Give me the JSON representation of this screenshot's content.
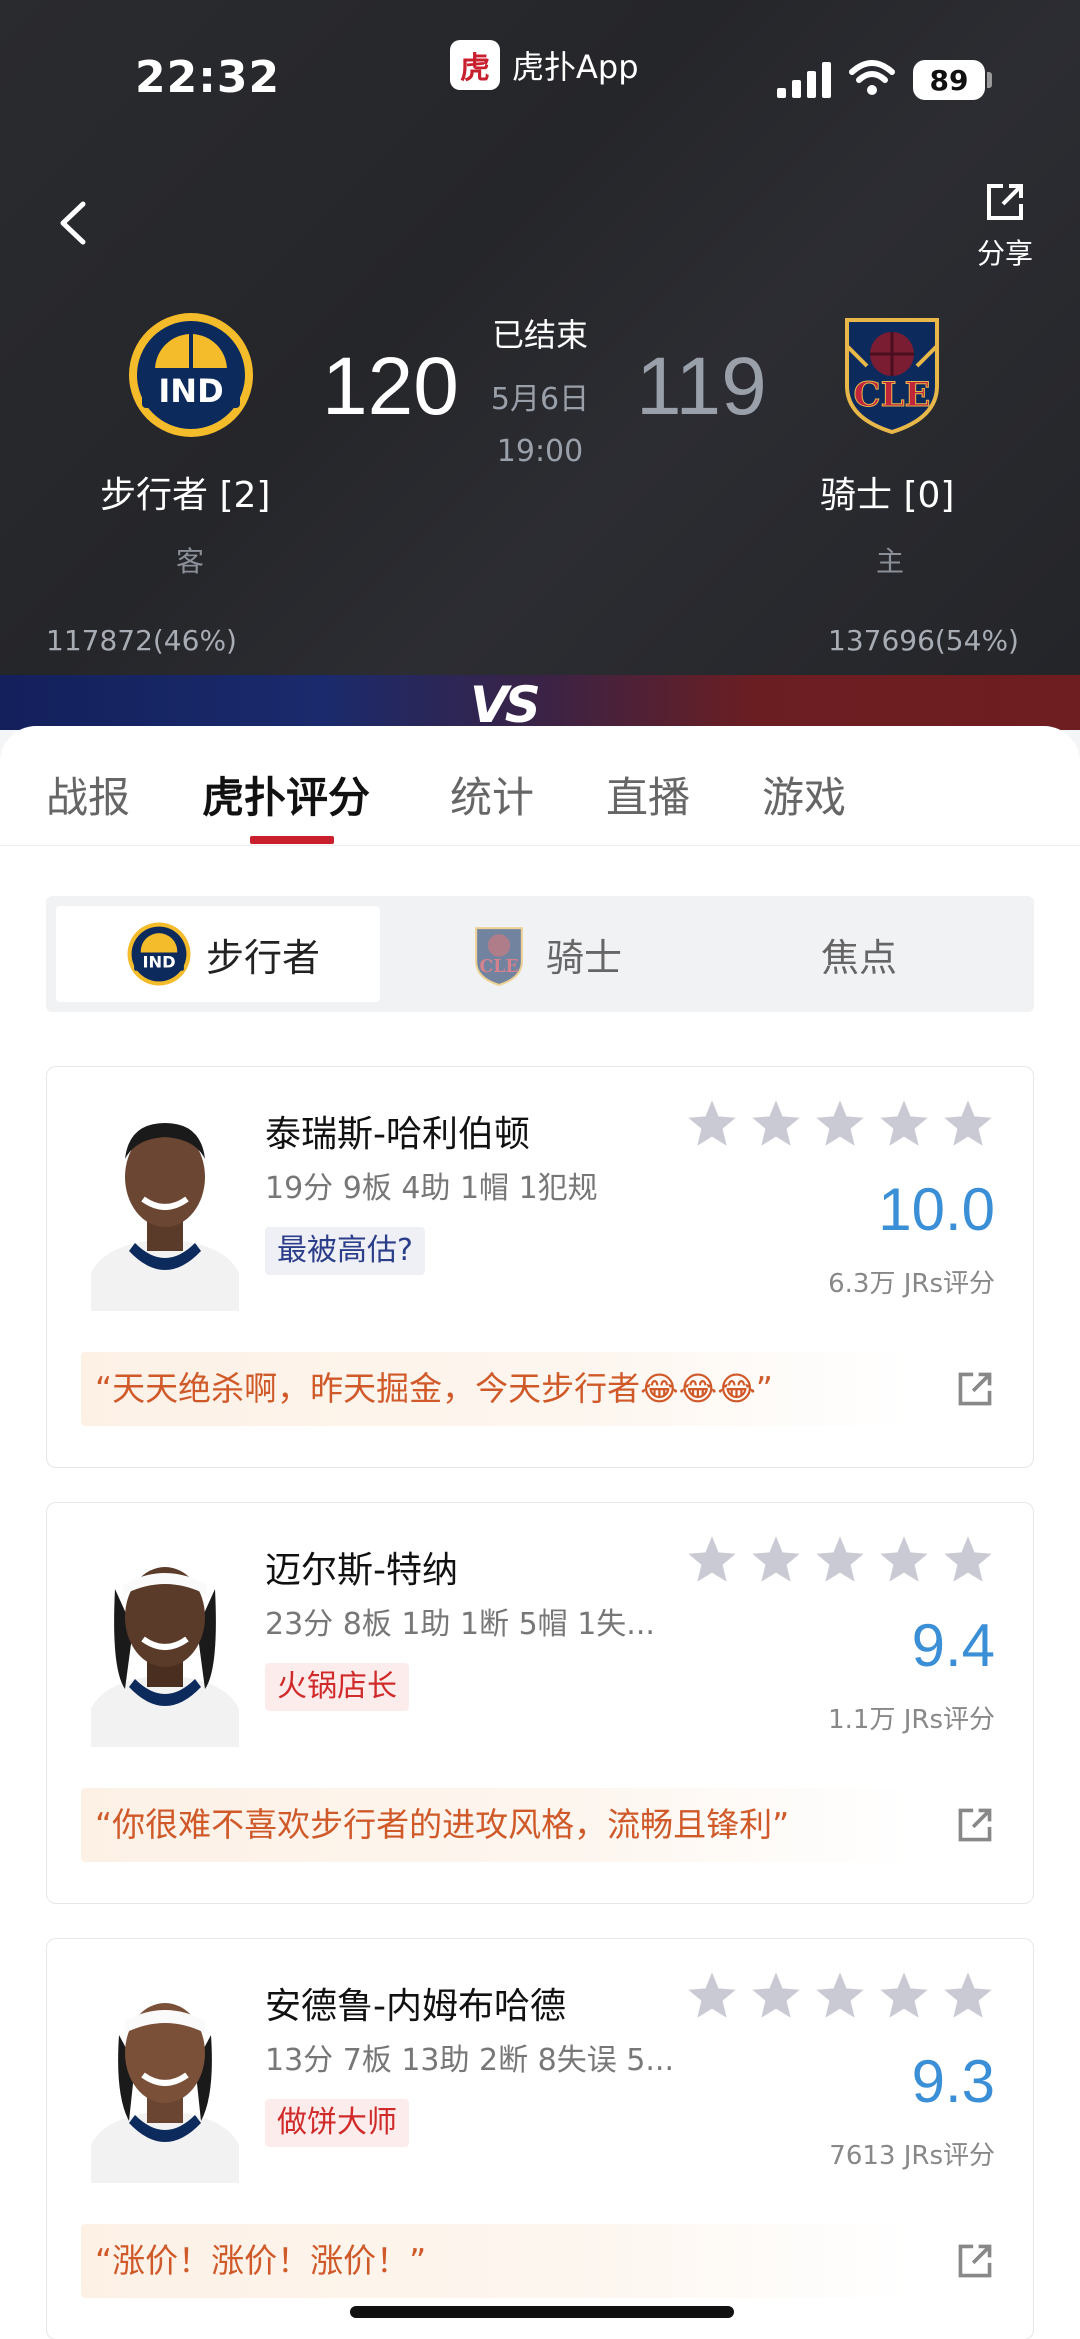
{
  "status_bar": {
    "time": "22:32",
    "app_logo_char": "虎",
    "app_name": "虎扑App",
    "battery": "89"
  },
  "header": {
    "share_label": "分享",
    "game_status": "已结束",
    "game_date": "5月6日",
    "game_time": "19:00",
    "away": {
      "name": "步行者 [2]",
      "role": "客",
      "score": "120",
      "support": "117872(46%)",
      "logo_text": "IND"
    },
    "home": {
      "name": "骑士 [0]",
      "role": "主",
      "score": "119",
      "support": "137696(54%)",
      "logo_text": "CLE"
    },
    "vs_text": "VS"
  },
  "tabs": [
    "战报",
    "虎扑评分",
    "统计",
    "直播",
    "游戏"
  ],
  "active_tab": "虎扑评分",
  "segments": {
    "ind": "步行者",
    "cle": "骑士",
    "focus": "焦点"
  },
  "players": [
    {
      "name": "泰瑞斯-哈利伯顿",
      "stats": "19分 9板 4助 1帽 1犯规",
      "tag": "最被高估?",
      "rating": "10.0",
      "votes": "6.3万 JRs评分",
      "quote": "“天天绝杀啊，昨天掘金，今天步行者😂😂😂”"
    },
    {
      "name": "迈尔斯-特纳",
      "stats": "23分 8板 1助 1断 5帽 1失...",
      "tag": "火锅店长",
      "rating": "9.4",
      "votes": "1.1万 JRs评分",
      "quote": "“你很难不喜欢步行者的进攻风格，流畅且锋利”"
    },
    {
      "name": "安德鲁-内姆布哈德",
      "stats": "13分 7板 13助 2断 8失误 5...",
      "tag": "做饼大师",
      "rating": "9.3",
      "votes": "7613 JRs评分",
      "quote": "“涨价！涨价！涨价！”"
    }
  ],
  "colors": {
    "accent": "#c8202f",
    "rating": "#3a8fd6",
    "quote": "#d0592a",
    "star": "#c9cad3"
  }
}
